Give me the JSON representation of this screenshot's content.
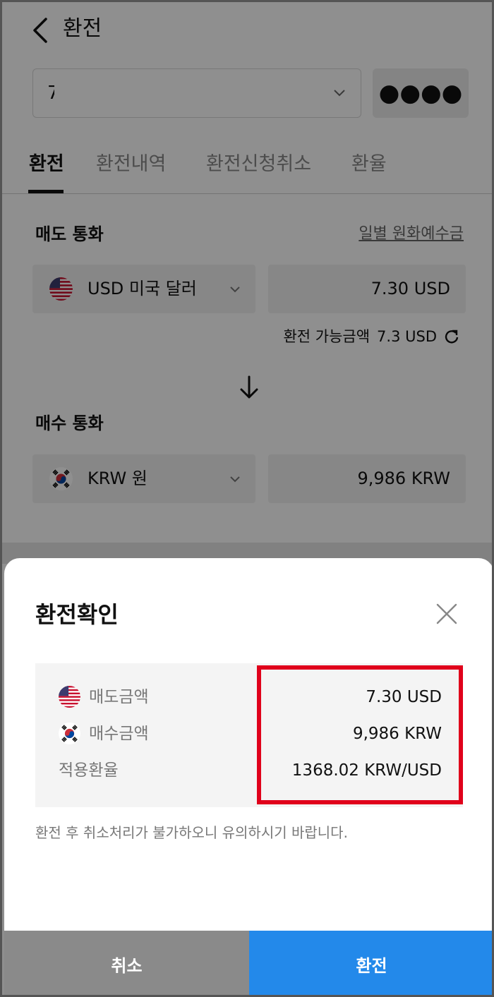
{
  "header": {
    "title": "환전"
  },
  "account": {
    "value": "7",
    "mask": "●●●●"
  },
  "tabs": [
    {
      "label": "환전",
      "active": true
    },
    {
      "label": "환전내역",
      "active": false
    },
    {
      "label": "환전신청취소",
      "active": false
    },
    {
      "label": "환율",
      "active": false
    }
  ],
  "sell": {
    "label": "매도 통화",
    "daily_link": "일별 원화예수금",
    "currency": "USD 미국 달러",
    "amount": "7.30 USD",
    "available_label": "환전 가능금액",
    "available_value": "7.3 USD"
  },
  "buy": {
    "label": "매수 통화",
    "currency": "KRW 원",
    "amount": "9,986 KRW"
  },
  "modal": {
    "title": "환전확인",
    "rows": [
      {
        "label": "매도금액",
        "value": "7.30 USD"
      },
      {
        "label": "매수금액",
        "value": "9,986 KRW"
      },
      {
        "label": "적용환율",
        "value": "1368.02 KRW/USD"
      }
    ],
    "notice": "환전 후 취소처리가 불가하오니 유의하시기 바랍니다.",
    "cancel_label": "취소",
    "confirm_label": "환전"
  },
  "colors": {
    "confirm": "#2389ea",
    "cancel": "#8a8a8a",
    "highlight": "#e0001b"
  }
}
